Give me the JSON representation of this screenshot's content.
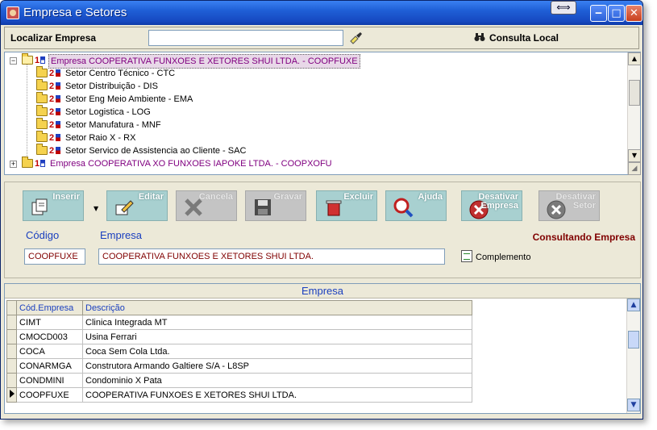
{
  "window": {
    "title": "Empresa e Setores"
  },
  "locate": {
    "label": "Localizar Empresa",
    "value": "",
    "consulta_label": "Consulta Local"
  },
  "tree": {
    "root": {
      "num": "1",
      "text": "Empresa COOPERATIVA FUNXOES E XETORES SHUI LTDA.  - COOPFUXE"
    },
    "children": [
      {
        "num": "2",
        "text": "Setor Centro Técnico  - CTC"
      },
      {
        "num": "2",
        "text": "Setor Distribuição  - DIS"
      },
      {
        "num": "2",
        "text": "Setor Eng Meio Ambiente  - EMA"
      },
      {
        "num": "2",
        "text": "Setor Logistica  - LOG"
      },
      {
        "num": "2",
        "text": "Setor Manufatura  - MNF"
      },
      {
        "num": "2",
        "text": "Setor Raio X  - RX"
      },
      {
        "num": "2",
        "text": "Setor Servico de Assistencia ao Cliente  - SAC"
      }
    ],
    "second": {
      "num": "1",
      "text": "Empresa COOPERATIVA XO FUNXOES IAPOKE LTDA.  - COOPXOFU"
    }
  },
  "toolbar": {
    "inserir": "Inserir",
    "editar": "Editar",
    "cancelar": "Cancela",
    "gravar": "Gravar",
    "excluir": "Excluir",
    "ajuda": "Ajuda",
    "desativar_empresa_1": "Desativar",
    "desativar_empresa_2": "Empresa",
    "desativar_setor_1": "Desativar",
    "desativar_setor_2": "Setor"
  },
  "form": {
    "codigo_label": "Código",
    "empresa_label": "Empresa",
    "codigo_value": "COOPFUXE",
    "empresa_value": "COOPERATIVA FUNXOES E XETORES SHUI LTDA.",
    "status": "Consultando Empresa",
    "complemento": "Complemento"
  },
  "grid": {
    "caption": "Empresa",
    "headers": [
      "Cód.Empresa",
      "Descrição"
    ],
    "rows": [
      {
        "code": "CIMT",
        "desc": "Clinica Integrada MT"
      },
      {
        "code": "CMOCD003",
        "desc": "Usina Ferrari"
      },
      {
        "code": "COCA",
        "desc": "Coca Sem Cola Ltda."
      },
      {
        "code": "CONARMGA",
        "desc": "Construtora Armando Galtiere S/A - L8SP"
      },
      {
        "code": "CONDMINI",
        "desc": "Condominio X Pata"
      },
      {
        "code": "COOPFUXE",
        "desc": "COOPERATIVA FUNXOES E XETORES SHUI LTDA."
      }
    ]
  }
}
